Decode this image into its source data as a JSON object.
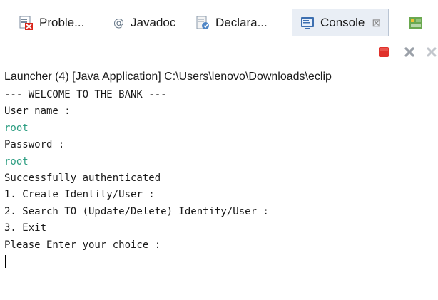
{
  "tabs": [
    {
      "label": "Proble...",
      "icon": "problems-icon",
      "active": false
    },
    {
      "label": "Javadoc",
      "icon": "javadoc-icon",
      "active": false
    },
    {
      "label": "Declara...",
      "icon": "declaration-icon",
      "active": false
    },
    {
      "label": "Console",
      "icon": "console-icon",
      "active": true,
      "close": "⊠"
    },
    {
      "label": "",
      "icon": "progress-icon",
      "active": false
    }
  ],
  "toolbar": {
    "terminate": "terminate-icon",
    "remove_launch": "remove-launch-icon",
    "remove_all": "remove-all-icon"
  },
  "launcher": "Launcher (4) [Java Application] C:\\Users\\lenovo\\Downloads\\eclip",
  "console": {
    "lines": [
      {
        "text": "--- WELCOME TO THE BANK ---",
        "type": "output"
      },
      {
        "text": "User name :",
        "type": "output"
      },
      {
        "text": "root",
        "type": "input"
      },
      {
        "text": "Password :",
        "type": "output"
      },
      {
        "text": "root",
        "type": "input"
      },
      {
        "text": "Successfully authenticated",
        "type": "output"
      },
      {
        "text": "1. Create Identity/User :",
        "type": "output"
      },
      {
        "text": "2. Search TO (Update/Delete) Identity/User :",
        "type": "output"
      },
      {
        "text": "3. Exit",
        "type": "output"
      },
      {
        "text": "Please Enter your choice :",
        "type": "output"
      }
    ]
  },
  "colors": {
    "input_text": "#2e9e82",
    "active_tab_bg": "#e9eef5",
    "terminate_red": "#e0312b"
  }
}
